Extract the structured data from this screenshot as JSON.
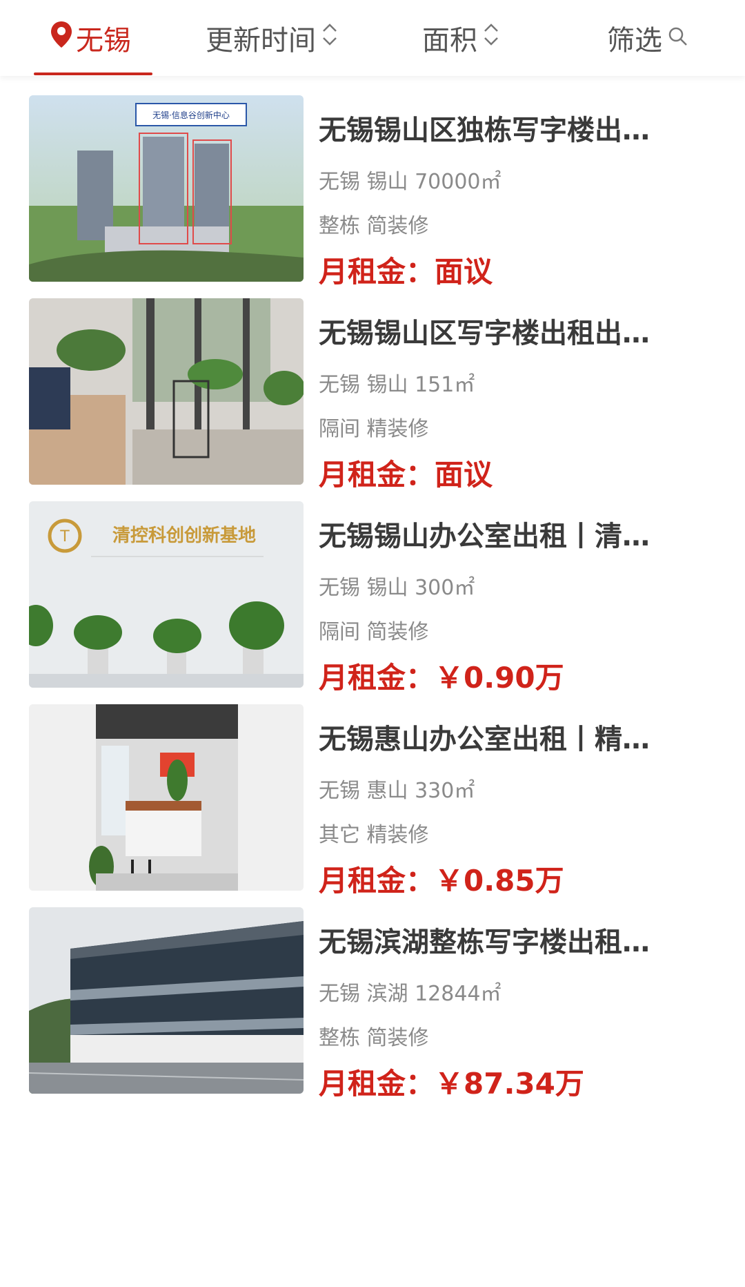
{
  "tabs": {
    "city": "无锡",
    "update_time": "更新时间",
    "area": "面积",
    "filter": "筛选"
  },
  "listings": [
    {
      "title": "无锡锡山区独栋写字楼出…",
      "location": "无锡 锡山 70000㎡",
      "features": "整栋 简装修",
      "price": "月租金：面议",
      "image_text": "无锡·信息谷创新中心"
    },
    {
      "title": "无锡锡山区写字楼出租出…",
      "location": "无锡 锡山 151㎡",
      "features": "隔间 精装修",
      "price": "月租金：面议"
    },
    {
      "title": "无锡锡山办公室出租丨清…",
      "location": "无锡 锡山 300㎡",
      "features": "隔间 简装修",
      "price": "月租金：￥0.90万",
      "image_text": "清控科创创新基地"
    },
    {
      "title": "无锡惠山办公室出租丨精…",
      "location": "无锡 惠山 330㎡",
      "features": "其它 精装修",
      "price": "月租金：￥0.85万"
    },
    {
      "title": "无锡滨湖整栋写字楼出租…",
      "location": "无锡 滨湖 12844㎡",
      "features": "整栋 简装修",
      "price": "月租金：￥87.34万"
    }
  ],
  "colors": {
    "accent": "#c9271d",
    "price": "#d0231a"
  }
}
